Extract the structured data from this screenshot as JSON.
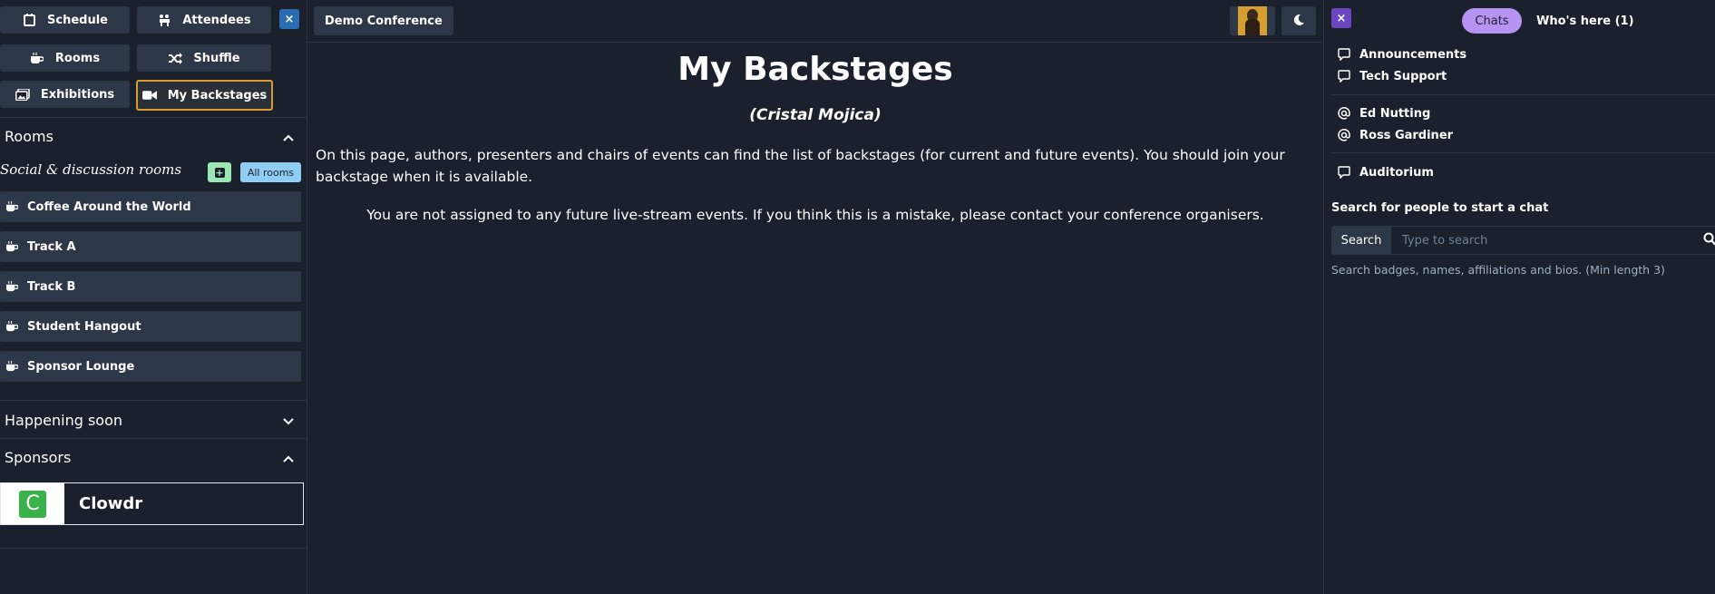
{
  "left": {
    "nav": {
      "schedule": "Schedule",
      "attendees": "Attendees",
      "rooms": "Rooms",
      "shuffle": "Shuffle",
      "exhibitions": "Exhibitions",
      "my_backstages": "My Backstages"
    },
    "close_label": "×",
    "rooms_section": {
      "title": "Rooms",
      "subheading": "Social & discussion rooms",
      "add_label": "+",
      "all_rooms_label": "All rooms",
      "items": [
        {
          "label": "Coffee Around the World"
        },
        {
          "label": "Track A"
        },
        {
          "label": "Track B"
        },
        {
          "label": "Student Hangout"
        },
        {
          "label": "Sponsor Lounge"
        }
      ]
    },
    "happening_soon": {
      "title": "Happening soon"
    },
    "sponsors": {
      "title": "Sponsors",
      "items": [
        {
          "logo_letter": "C",
          "name": "Clowdr",
          "logo_color": "#38b249"
        }
      ]
    }
  },
  "center": {
    "conference_button": "Demo Conference",
    "title": "My Backstages",
    "subtitle": "(Cristal Mojica)",
    "description": "On this page, authors, presenters and chairs of events can find the list of backstages (for current and future events). You should join your backstage when it is available.",
    "empty_message": "You are not assigned to any future live-stream events. If you think this is a mistake, please contact your conference organisers."
  },
  "right": {
    "close_label": "×",
    "tabs": {
      "chats": "Chats",
      "whos_here": "Who's here (1)"
    },
    "channels": [
      {
        "label": "Announcements",
        "icon": "chat-bubble-icon"
      },
      {
        "label": "Tech Support",
        "icon": "chat-bubble-icon"
      }
    ],
    "direct_messages": [
      {
        "label": "Ed Nutting",
        "icon": "at-icon"
      },
      {
        "label": "Ross Gardiner",
        "icon": "at-icon"
      }
    ],
    "rooms": [
      {
        "label": "Auditorium",
        "icon": "chat-bubble-icon"
      }
    ],
    "search": {
      "label": "Search for people to start a chat",
      "button": "Search",
      "placeholder": "Type to search",
      "hint": "Search badges, names, affiliations and bios. (Min length 3)"
    }
  },
  "colors": {
    "background": "#1a202c",
    "panel": "#2d3748",
    "active_border": "#d69e2e",
    "chats_tab": "#b794f4",
    "close_left": "#2b6cb0",
    "close_right": "#6b46c1",
    "add_button": "#9ae6b4",
    "all_rooms_button": "#90cdf4"
  }
}
